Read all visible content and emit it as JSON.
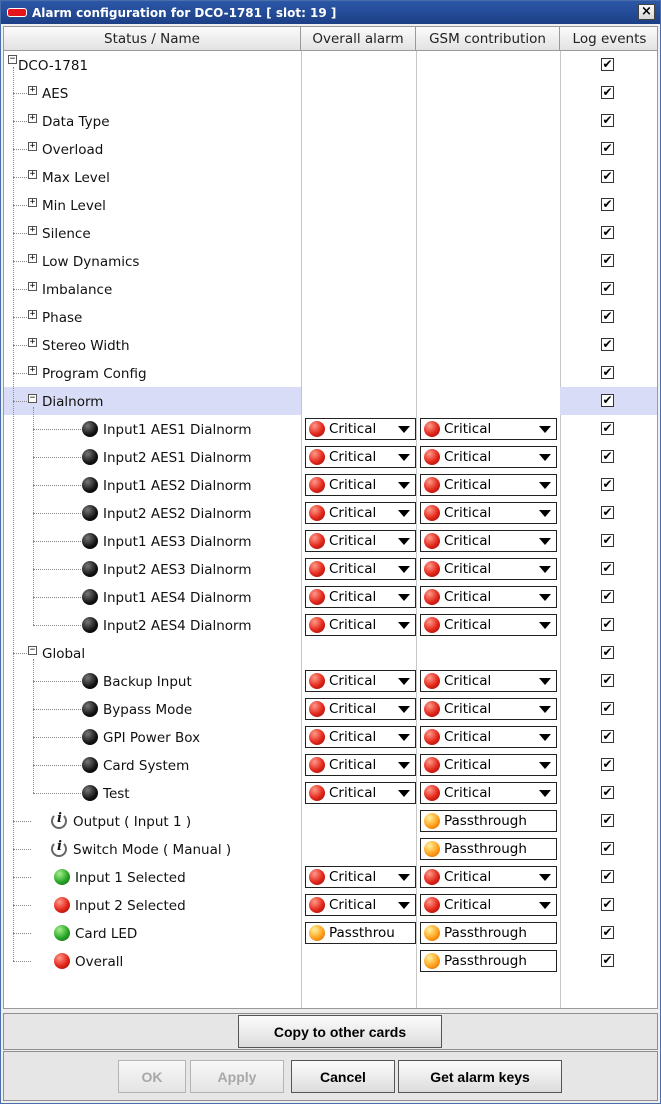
{
  "window": {
    "title": "Alarm configuration for DCO-1781 [ slot: 19 ]",
    "close_label": "×"
  },
  "columns": {
    "name": "Status / Name",
    "overall": "Overall alarm",
    "gsm": "GSM contribution",
    "log": "Log events"
  },
  "check_mark": "✔",
  "expand_plus": "+",
  "expand_minus": "−",
  "rows": [
    {
      "label": "DCO-1781",
      "indent": 0,
      "expander": "minus",
      "icon": "",
      "overall": "",
      "gsm": "",
      "log": true
    },
    {
      "label": "AES",
      "indent": 1,
      "expander": "plus",
      "icon": "",
      "overall": "",
      "gsm": "",
      "log": true
    },
    {
      "label": "Data Type",
      "indent": 1,
      "expander": "plus",
      "icon": "",
      "overall": "",
      "gsm": "",
      "log": true
    },
    {
      "label": "Overload",
      "indent": 1,
      "expander": "plus",
      "icon": "",
      "overall": "",
      "gsm": "",
      "log": true
    },
    {
      "label": "Max Level",
      "indent": 1,
      "expander": "plus",
      "icon": "",
      "overall": "",
      "gsm": "",
      "log": true
    },
    {
      "label": "Min Level",
      "indent": 1,
      "expander": "plus",
      "icon": "",
      "overall": "",
      "gsm": "",
      "log": true
    },
    {
      "label": "Silence",
      "indent": 1,
      "expander": "plus",
      "icon": "",
      "overall": "",
      "gsm": "",
      "log": true
    },
    {
      "label": "Low Dynamics",
      "indent": 1,
      "expander": "plus",
      "icon": "",
      "overall": "",
      "gsm": "",
      "log": true
    },
    {
      "label": "Imbalance",
      "indent": 1,
      "expander": "plus",
      "icon": "",
      "overall": "",
      "gsm": "",
      "log": true
    },
    {
      "label": "Phase",
      "indent": 1,
      "expander": "plus",
      "icon": "",
      "overall": "",
      "gsm": "",
      "log": true
    },
    {
      "label": "Stereo Width",
      "indent": 1,
      "expander": "plus",
      "icon": "",
      "overall": "",
      "gsm": "",
      "log": true
    },
    {
      "label": "Program Config",
      "indent": 1,
      "expander": "plus",
      "icon": "",
      "overall": "",
      "gsm": "",
      "log": true
    },
    {
      "label": "Dialnorm",
      "indent": 1,
      "expander": "minus",
      "icon": "",
      "overall": "",
      "gsm": "",
      "log": true,
      "selected": true
    },
    {
      "label": "Input1 AES1 Dialnorm",
      "indent": 2,
      "expander": "",
      "icon": "black",
      "overall": "Critical",
      "gsm": "Critical",
      "log": true
    },
    {
      "label": "Input2 AES1 Dialnorm",
      "indent": 2,
      "expander": "",
      "icon": "black",
      "overall": "Critical",
      "gsm": "Critical",
      "log": true
    },
    {
      "label": "Input1 AES2 Dialnorm",
      "indent": 2,
      "expander": "",
      "icon": "black",
      "overall": "Critical",
      "gsm": "Critical",
      "log": true
    },
    {
      "label": "Input2 AES2 Dialnorm",
      "indent": 2,
      "expander": "",
      "icon": "black",
      "overall": "Critical",
      "gsm": "Critical",
      "log": true
    },
    {
      "label": "Input1 AES3 Dialnorm",
      "indent": 2,
      "expander": "",
      "icon": "black",
      "overall": "Critical",
      "gsm": "Critical",
      "log": true
    },
    {
      "label": "Input2 AES3 Dialnorm",
      "indent": 2,
      "expander": "",
      "icon": "black",
      "overall": "Critical",
      "gsm": "Critical",
      "log": true
    },
    {
      "label": "Input1 AES4 Dialnorm",
      "indent": 2,
      "expander": "",
      "icon": "black",
      "overall": "Critical",
      "gsm": "Critical",
      "log": true
    },
    {
      "label": "Input2 AES4 Dialnorm",
      "indent": 2,
      "expander": "",
      "icon": "black",
      "overall": "Critical",
      "gsm": "Critical",
      "log": true
    },
    {
      "label": "Global",
      "indent": 1,
      "expander": "minus",
      "icon": "",
      "overall": "",
      "gsm": "",
      "log": true
    },
    {
      "label": "Backup Input",
      "indent": 2,
      "expander": "",
      "icon": "black",
      "overall": "Critical",
      "gsm": "Critical",
      "log": true
    },
    {
      "label": "Bypass Mode",
      "indent": 2,
      "expander": "",
      "icon": "black",
      "overall": "Critical",
      "gsm": "Critical",
      "log": true
    },
    {
      "label": "GPI Power Box",
      "indent": 2,
      "expander": "",
      "icon": "black",
      "overall": "Critical",
      "gsm": "Critical",
      "log": true
    },
    {
      "label": "Card System",
      "indent": 2,
      "expander": "",
      "icon": "black",
      "overall": "Critical",
      "gsm": "Critical",
      "log": true
    },
    {
      "label": "Test",
      "indent": 2,
      "expander": "",
      "icon": "black",
      "overall": "Critical",
      "gsm": "Critical",
      "log": true
    },
    {
      "label": "Output ( Input 1 )",
      "indent": 1,
      "expander": "",
      "icon": "info",
      "overall": "",
      "gsm": "Passthrough",
      "log": true
    },
    {
      "label": "Switch Mode ( Manual )",
      "indent": 1,
      "expander": "",
      "icon": "info",
      "overall": "",
      "gsm": "Passthrough",
      "log": true
    },
    {
      "label": "Input 1 Selected",
      "indent": 1,
      "expander": "",
      "icon": "green",
      "overall": "Critical",
      "gsm": "Critical",
      "log": true
    },
    {
      "label": "Input 2 Selected",
      "indent": 1,
      "expander": "",
      "icon": "red",
      "overall": "Critical",
      "gsm": "Critical",
      "log": true
    },
    {
      "label": "Card LED",
      "indent": 1,
      "expander": "",
      "icon": "green",
      "overall": "Passthrou",
      "gsm": "Passthrough",
      "log": true
    },
    {
      "label": "Overall",
      "indent": 1,
      "expander": "",
      "icon": "red",
      "overall": "",
      "gsm": "Passthrough",
      "log": true
    }
  ],
  "buttons": {
    "copy": "Copy to other cards",
    "ok": "OK",
    "apply": "Apply",
    "cancel": "Cancel",
    "get_keys": "Get alarm keys"
  }
}
